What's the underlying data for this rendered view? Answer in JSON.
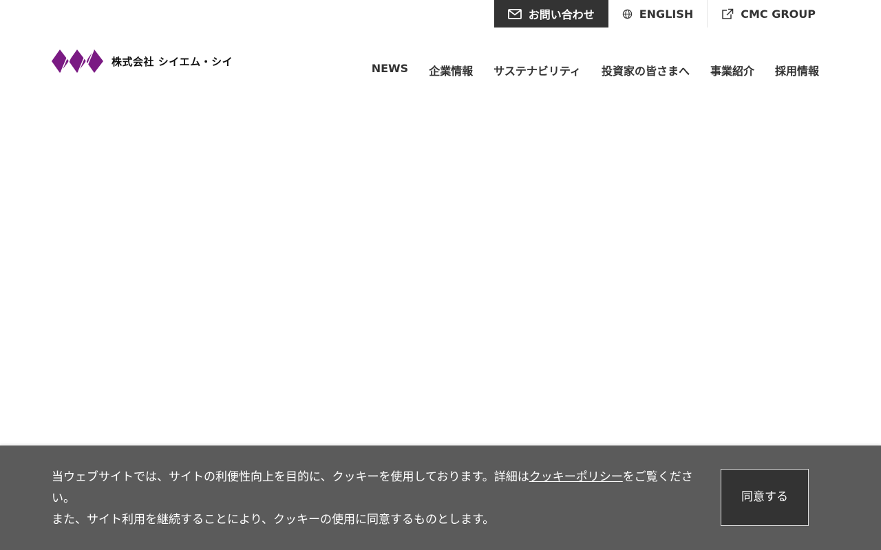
{
  "header": {
    "utility_links": [
      {
        "label": "お問い合わせ",
        "icon": "mail-icon"
      },
      {
        "label": "ENGLISH",
        "icon": "globe-icon"
      },
      {
        "label": "CMC GROUP",
        "icon": "external-link-icon"
      }
    ],
    "logo": {
      "company_name": "株式会社 シイエム・シイ",
      "brand_color": "#7a1a83"
    },
    "nav": [
      "NEWS",
      "企業情報",
      "サステナビリティ",
      "投資家の皆さまへ",
      "事業紹介",
      "採用情報"
    ]
  },
  "cookie_banner": {
    "text_before_link": "当ウェブサイトでは、サイトの利便性向上を目的に、クッキーを使用しております。詳細は",
    "link_label": "クッキーポリシー",
    "text_after_link": "をご覧ください。",
    "line2": "また、サイト利用を継続することにより、クッキーの使用に同意するものとします。",
    "accept_label": "同意する"
  }
}
